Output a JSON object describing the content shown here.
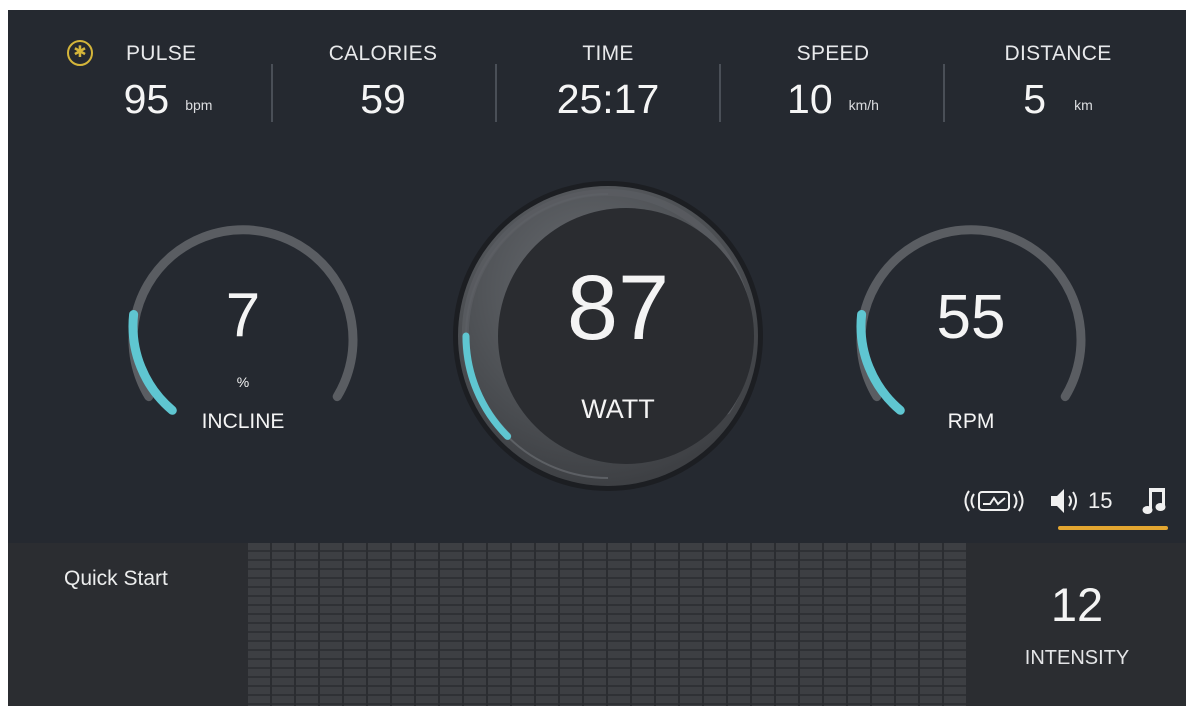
{
  "stats": {
    "pulse": {
      "label": "PULSE",
      "value": "95",
      "unit": "bpm"
    },
    "calories": {
      "label": "CALORIES",
      "value": "59"
    },
    "time": {
      "label": "TIME",
      "value": "25:17"
    },
    "speed": {
      "label": "SPEED",
      "value": "10",
      "unit": "km/h"
    },
    "distance": {
      "label": "DISTANCE",
      "value": "5",
      "unit": "km"
    }
  },
  "incline": {
    "value": "7",
    "unit": "%",
    "label": "INCLINE",
    "fill_fraction": 0.2
  },
  "watt": {
    "value": "87",
    "label": "WATT",
    "fill_fraction": 0.15
  },
  "rpm": {
    "value": "55",
    "label": "RPM",
    "fill_fraction": 0.2
  },
  "status_bar": {
    "volume": "15",
    "icons": [
      "bluetooth-icon",
      "heart-rate-sensor-icon",
      "speaker-icon",
      "music-note-icon"
    ]
  },
  "bottom": {
    "mode": "Quick Start",
    "intensity_value": "12",
    "intensity_label": "INTENSITY"
  },
  "colors": {
    "background": "#252930",
    "accent_cyan": "#5fc6d1",
    "accent_gold": "#e3a630",
    "bluetooth": "#d4b53a"
  }
}
